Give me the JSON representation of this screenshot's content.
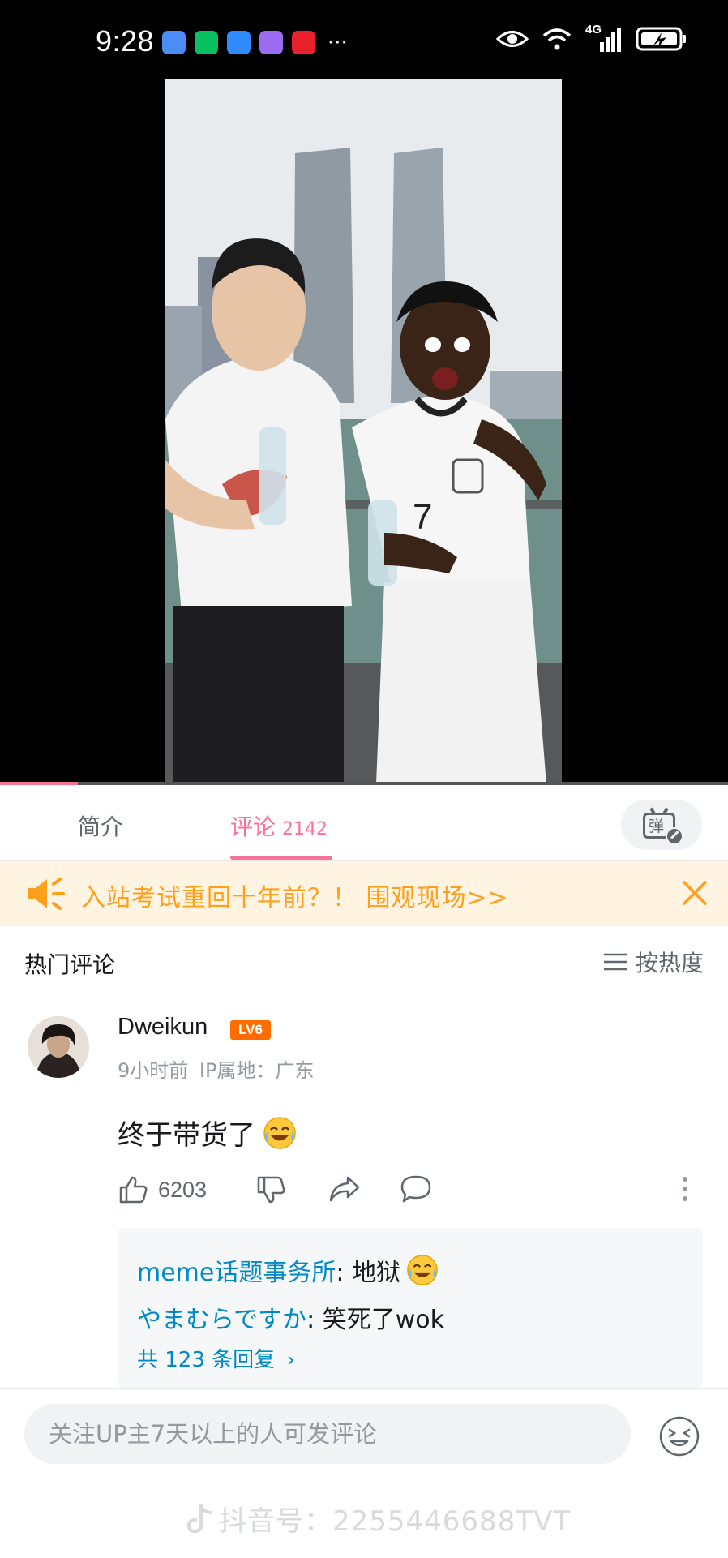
{
  "status_bar": {
    "time": "9:28",
    "app_icons": [
      {
        "name": "shield-app-icon",
        "color": "#4a8df7"
      },
      {
        "name": "wechat-icon",
        "color": "#07c160"
      },
      {
        "name": "browser-app-icon",
        "color": "#2f8cff"
      },
      {
        "name": "purple-app-icon",
        "color": "#9b6cf2"
      },
      {
        "name": "red-app-icon",
        "color": "#e8212b"
      }
    ],
    "more": "···",
    "network_label": "4G"
  },
  "video": {
    "progress": 0.107
  },
  "tabs": {
    "intro_label": "简介",
    "comments_label": "评论",
    "comments_count": "2142",
    "danmaku_glyph": "弹"
  },
  "notice": {
    "text": "入站考试重回十年前？！ 围观现场>>"
  },
  "comments_section": {
    "title": "热门评论",
    "sort_label": "按热度"
  },
  "comment": {
    "username": "Dweikun",
    "level": "LV6",
    "time": "9小时前",
    "ip_location": "IP属地：广东",
    "text": "终于带货了",
    "likes": "6203",
    "replies": [
      {
        "name": "meme话题事务所",
        "text": ": 地狱"
      },
      {
        "name": "やまむらですか",
        "text": ": 笑死了wok"
      }
    ],
    "reply_count_text": "共 123 条回复"
  },
  "bottom_bar": {
    "input_placeholder": "关注UP主7天以上的人可发评论"
  },
  "watermark": {
    "text": "抖音号：2255446688TVT"
  },
  "colors": {
    "brand_pink": "#fb7299",
    "notice_orange": "#ff9f1c",
    "link_blue": "#008ac5",
    "level_orange": "#ff6c00"
  }
}
